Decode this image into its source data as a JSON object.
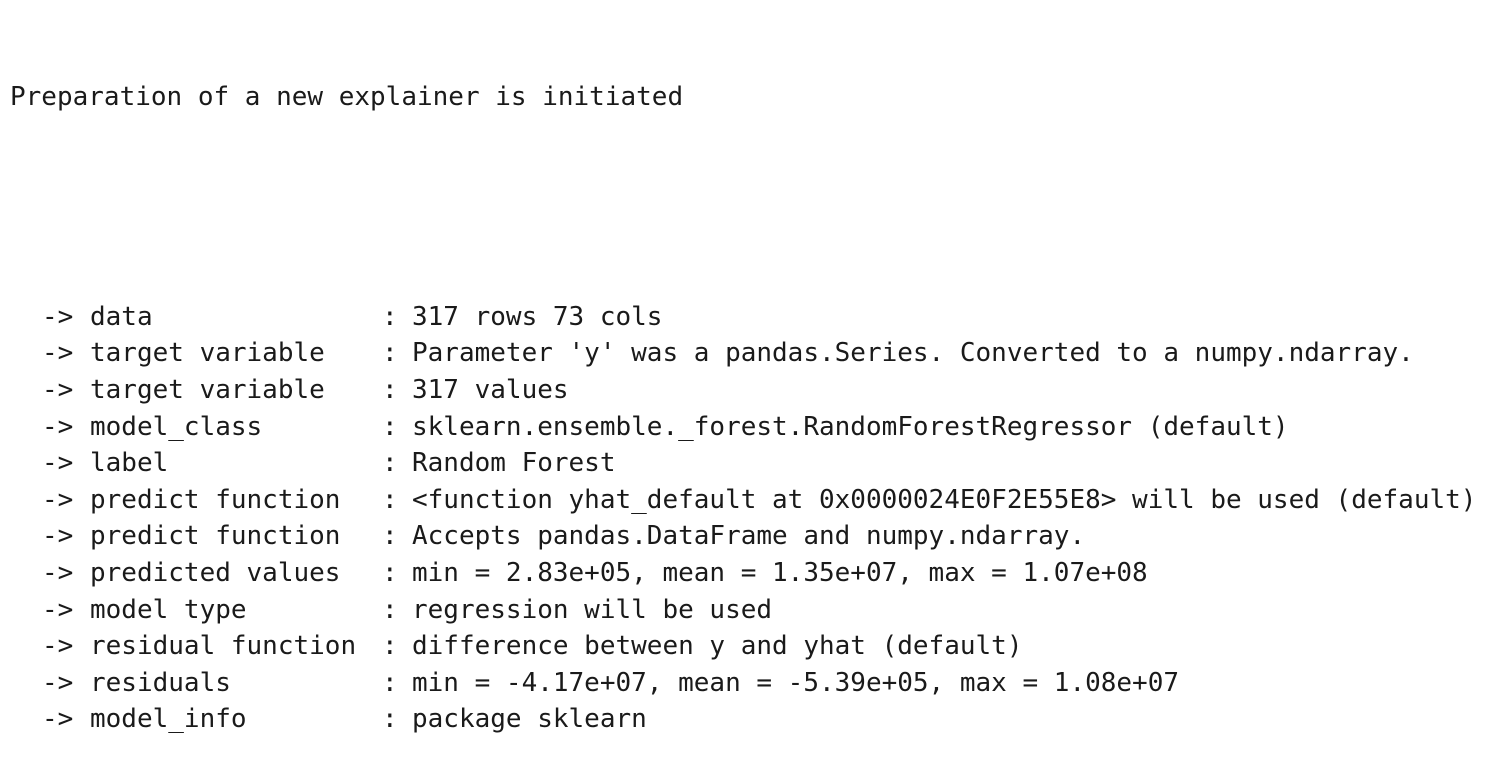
{
  "output": {
    "header": "Preparation of a new explainer is initiated",
    "arrow": "->",
    "separator": ":",
    "entries": [
      {
        "key": "data",
        "value": "317 rows 73 cols"
      },
      {
        "key": "target variable",
        "value": "Parameter 'y' was a pandas.Series. Converted to a numpy.ndarray."
      },
      {
        "key": "target variable",
        "value": "317 values"
      },
      {
        "key": "model_class",
        "value": "sklearn.ensemble._forest.RandomForestRegressor (default)"
      },
      {
        "key": "label",
        "value": "Random Forest"
      },
      {
        "key": "predict function",
        "value": "<function yhat_default at 0x0000024E0F2E55E8> will be used (default)"
      },
      {
        "key": "predict function",
        "value": "Accepts pandas.DataFrame and numpy.ndarray."
      },
      {
        "key": "predicted values",
        "value": "min = 2.83e+05, mean = 1.35e+07, max = 1.07e+08"
      },
      {
        "key": "model type",
        "value": "regression will be used"
      },
      {
        "key": "residual function",
        "value": "difference between y and yhat (default)"
      },
      {
        "key": "residuals",
        "value": "min = -4.17e+07, mean = -5.39e+05, max = 1.08e+07"
      },
      {
        "key": "model_info",
        "value": "package sklearn"
      }
    ]
  }
}
